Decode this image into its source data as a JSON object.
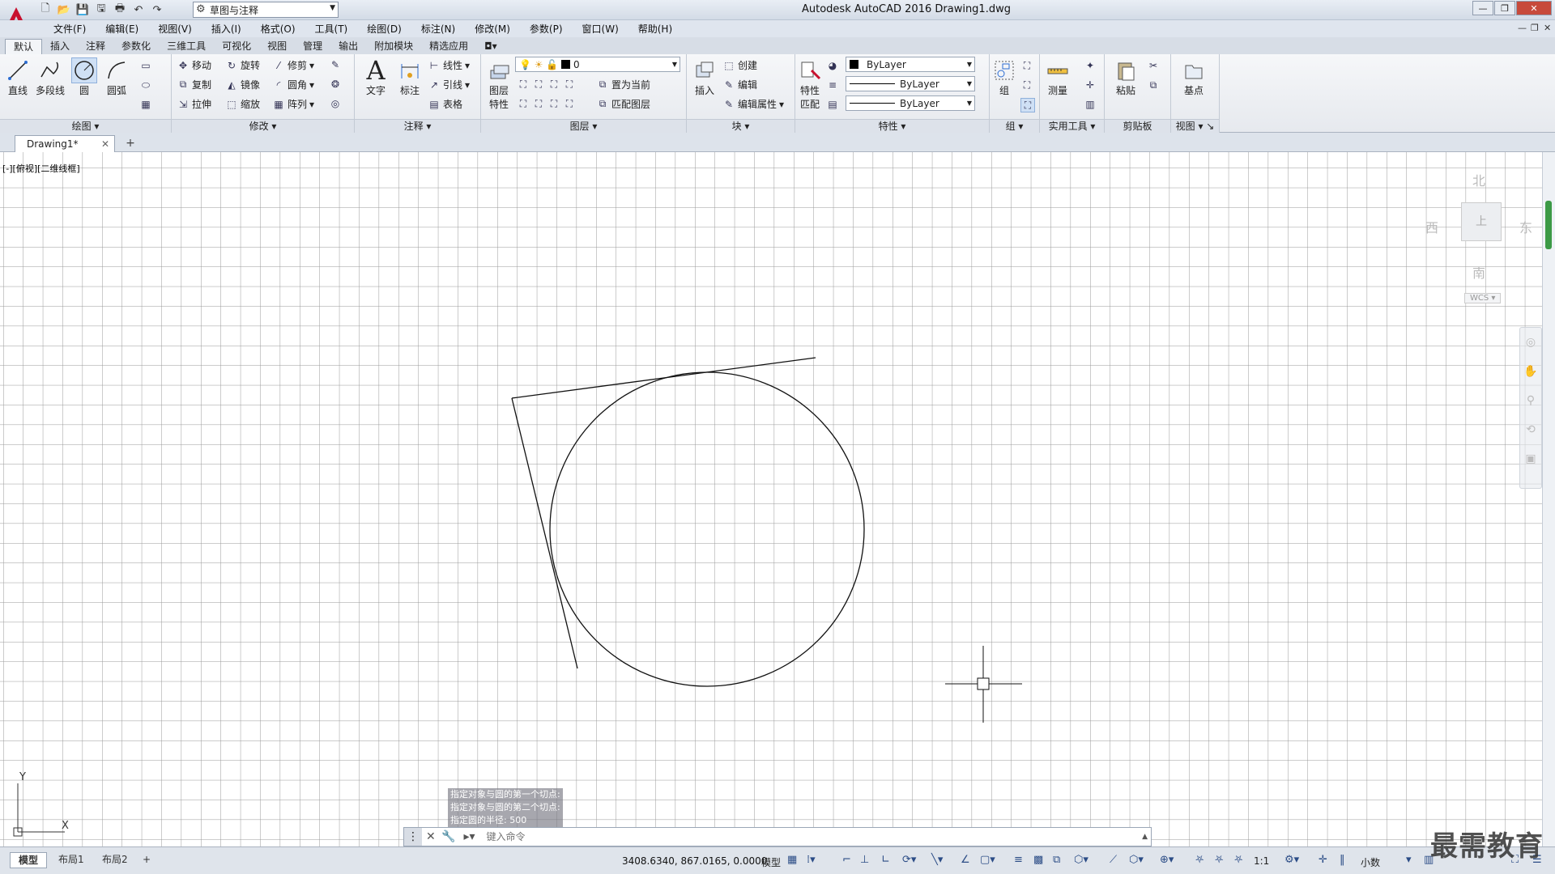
{
  "window": {
    "title": "Autodesk AutoCAD 2016    Drawing1.dwg",
    "workspace": "草图与注释"
  },
  "menu": [
    "文件(F)",
    "编辑(E)",
    "视图(V)",
    "插入(I)",
    "格式(O)",
    "工具(T)",
    "绘图(D)",
    "标注(N)",
    "修改(M)",
    "参数(P)",
    "窗口(W)",
    "帮助(H)"
  ],
  "ribbon_tabs": [
    "默认",
    "插入",
    "注释",
    "参数化",
    "三维工具",
    "可视化",
    "视图",
    "管理",
    "输出",
    "附加模块",
    "精选应用"
  ],
  "panels": {
    "draw": {
      "title": "绘图",
      "line": "直线",
      "polyline": "多段线",
      "circle": "圆",
      "arc": "圆弧"
    },
    "modify": {
      "title": "修改",
      "move": "移动",
      "rotate": "旋转",
      "trim": "修剪",
      "copy": "复制",
      "mirror": "镜像",
      "fillet": "圆角",
      "stretch": "拉伸",
      "scale": "缩放",
      "array": "阵列"
    },
    "annotation": {
      "title": "注释",
      "text": "文字",
      "dimension": "标注",
      "linear": "线性",
      "leader": "引线",
      "table": "表格"
    },
    "layers": {
      "title": "图层",
      "properties_line1": "图层",
      "properties_line2": "特性",
      "layer_name": "0",
      "make_current": "置为当前",
      "match": "匹配图层"
    },
    "block": {
      "title": "块",
      "insert": "插入",
      "create": "创建",
      "edit": "编辑",
      "edit_attr": "编辑属性"
    },
    "properties": {
      "title": "特性",
      "match_line1": "特性",
      "match_line2": "匹配",
      "color": "ByLayer",
      "linetype": "ByLayer",
      "lineweight": "ByLayer"
    },
    "groups": {
      "title": "组",
      "group": "组"
    },
    "utilities": {
      "title": "实用工具",
      "measure": "测量"
    },
    "clipboard": {
      "title": "剪贴板",
      "paste": "粘贴"
    },
    "view": {
      "title": "视图",
      "base": "基点"
    }
  },
  "document_tab": "Drawing1*",
  "viewport_label": "[-][俯视][二维线框]",
  "viewcube": {
    "north": "北",
    "south": "南",
    "east": "东",
    "west": "西",
    "top": "上",
    "wcs": "WCS"
  },
  "ucs": {
    "x": "X",
    "y": "Y"
  },
  "command_history": [
    "指定对象与圆的第一个切点:",
    "指定对象与圆的第二个切点:",
    "指定圆的半径: 500"
  ],
  "command_placeholder": "键入命令",
  "layout_tabs": [
    "模型",
    "布局1",
    "布局2"
  ],
  "status": {
    "coords": "3408.6340, 867.0165, 0.0000",
    "model": "模型",
    "scale": "1:1",
    "units": "小数"
  },
  "watermark": "最需教育",
  "colors": {
    "accent": "#c8102e",
    "grid": "#9a9a9a"
  }
}
